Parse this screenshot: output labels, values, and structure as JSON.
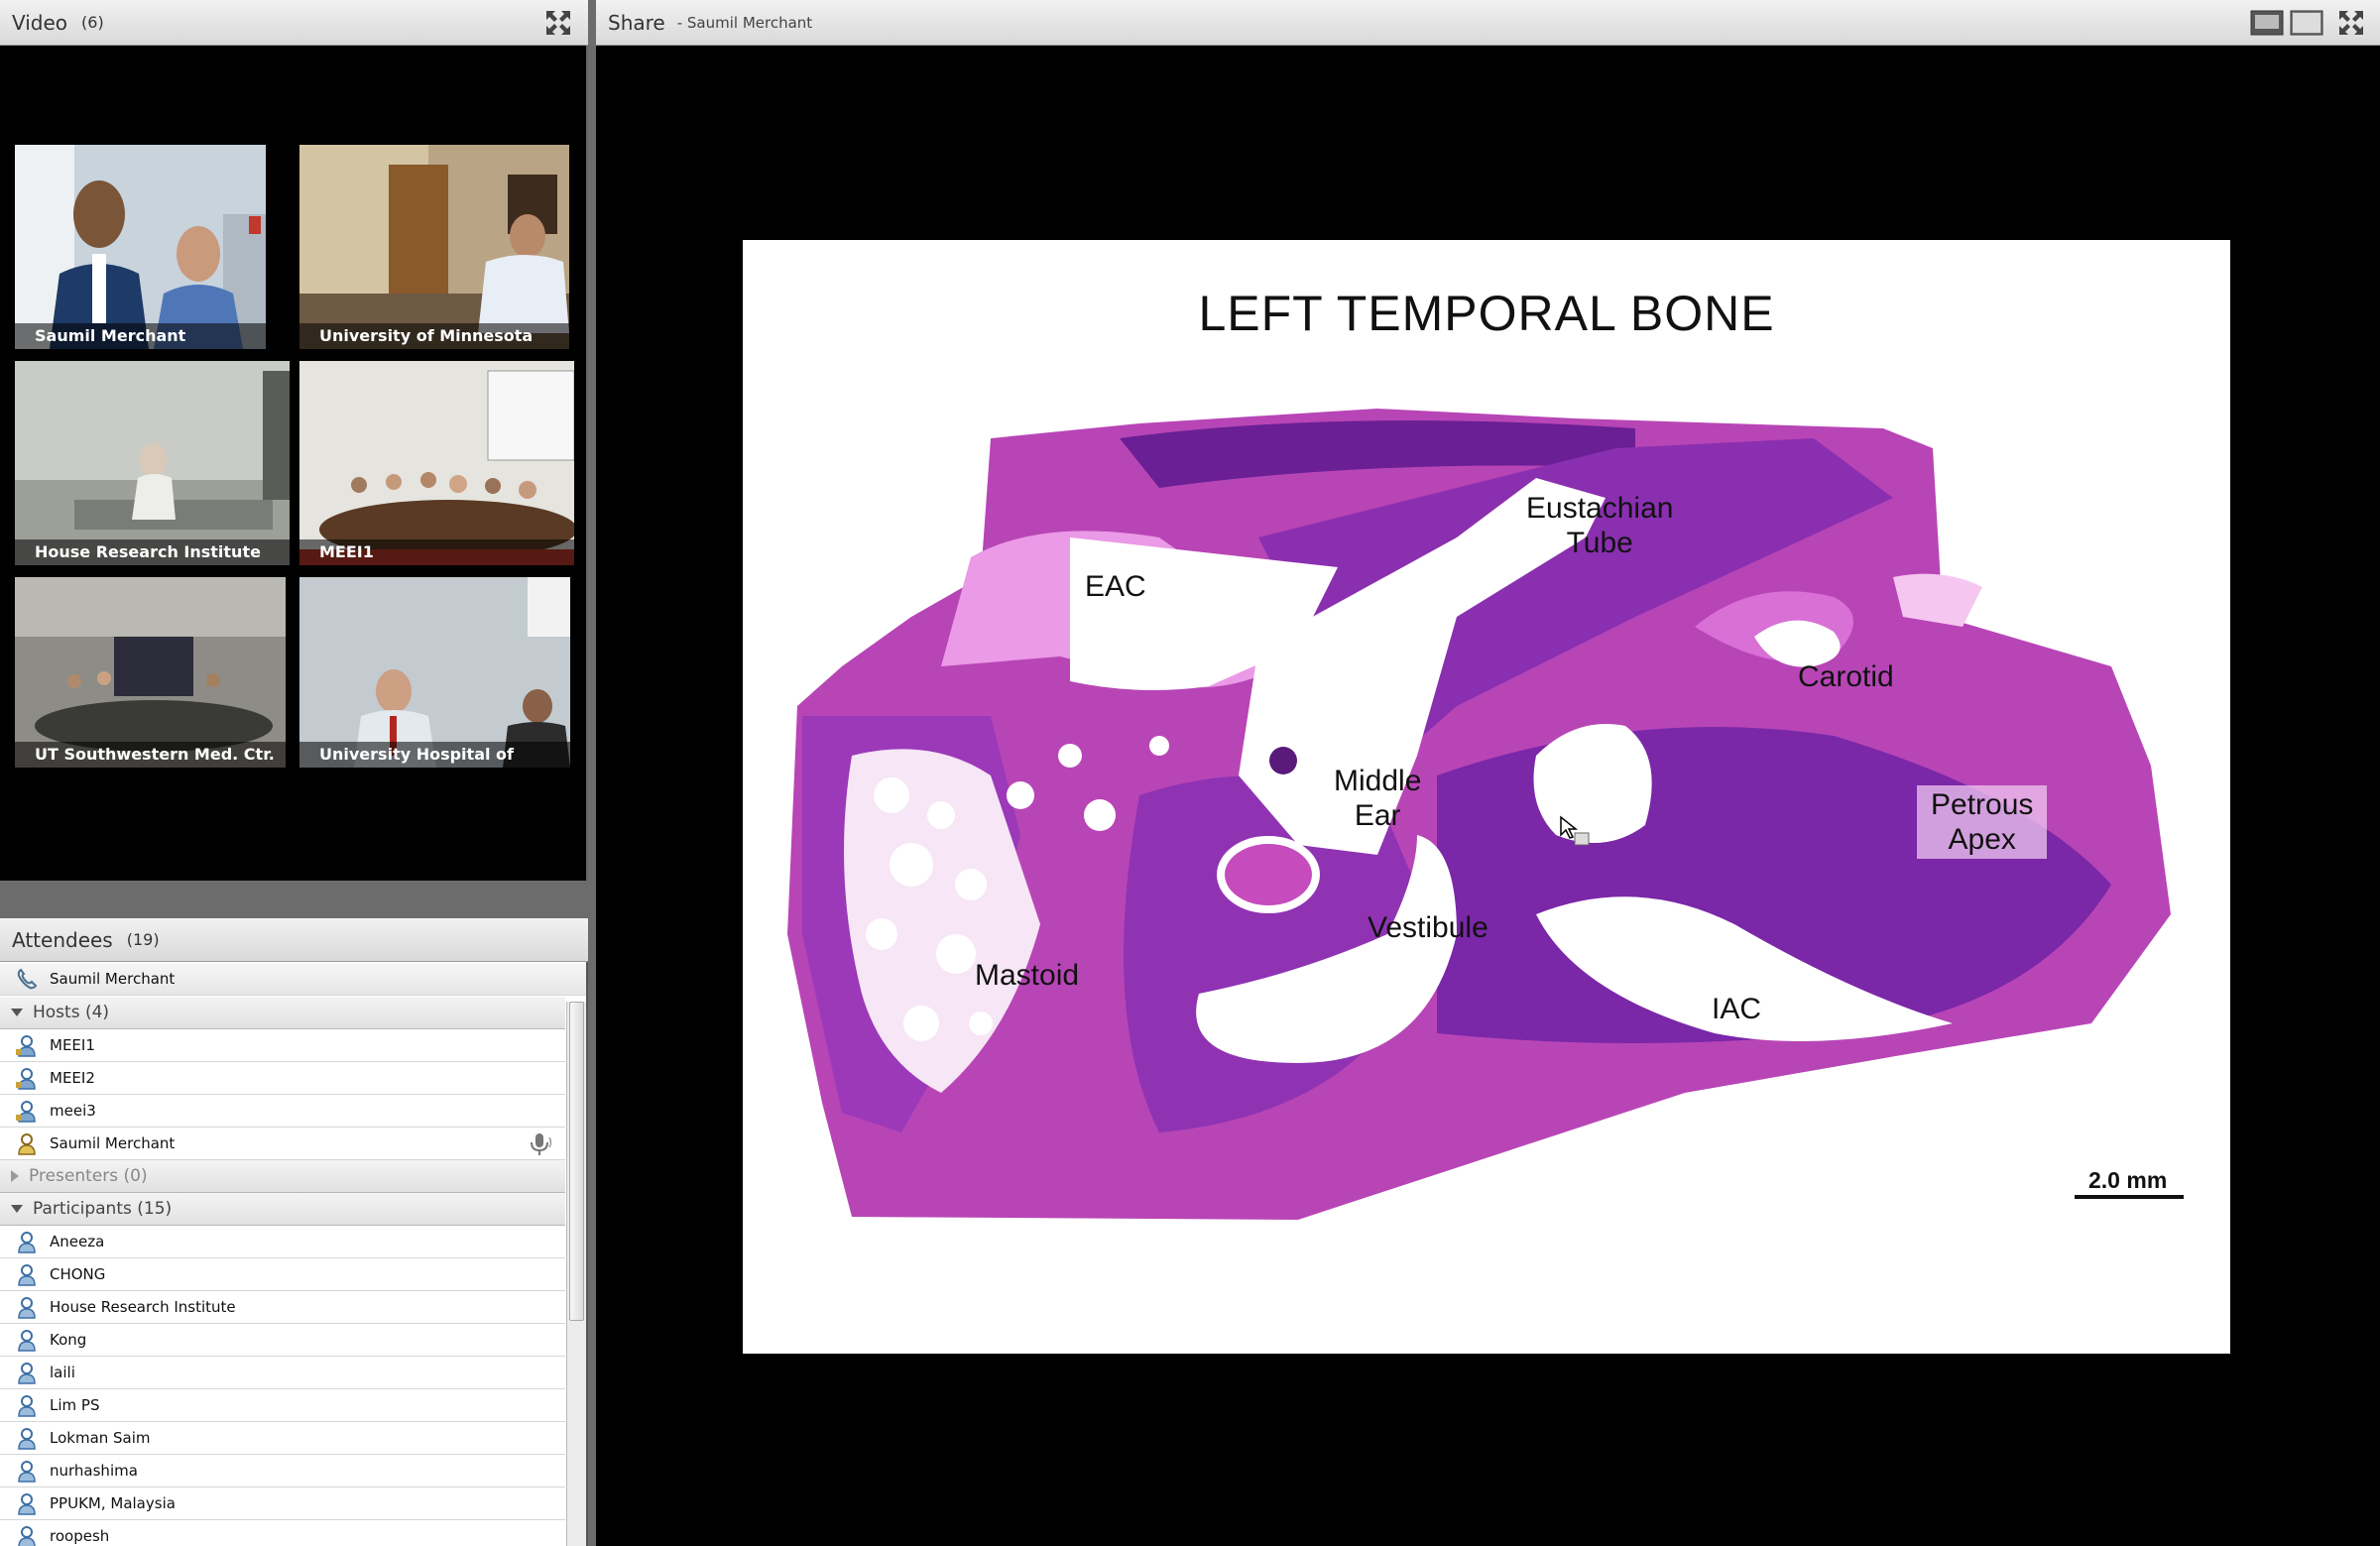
{
  "video_pod": {
    "title": "Video",
    "count": "(6)",
    "tiles": [
      {
        "name": "Saumil Merchant"
      },
      {
        "name": "University of Minnesota"
      },
      {
        "name": "House Research Institute"
      },
      {
        "name": "MEEI1"
      },
      {
        "name": "UT Southwestern Med. Ctr."
      },
      {
        "name": "University Hospital of Brasilia"
      }
    ]
  },
  "attendees_pod": {
    "title": "Attendees",
    "count": "(19)",
    "phone_user": "Saumil Merchant",
    "hosts_label": "Hosts (4)",
    "hosts": [
      "MEEI1",
      "MEEI2",
      "meei3",
      "Saumil Merchant"
    ],
    "presenters_label": "Presenters (0)",
    "participants_label": "Participants (15)",
    "participants": [
      "Aneeza",
      "CHONG",
      "House Research Institute",
      "Kong",
      "laili",
      "Lim PS",
      "Lokman Saim",
      "nurhashima",
      "PPUKM, Malaysia",
      "roopesh"
    ]
  },
  "share_pod": {
    "title": "Share",
    "subtitle": "- Saumil Merchant",
    "slide": {
      "title": "LEFT TEMPORAL BONE",
      "labels": {
        "eac": "EAC",
        "eustachian": "Eustachian\nTube",
        "carotid": "Carotid",
        "middle_ear": "Middle\nEar",
        "petrous": "Petrous\nApex",
        "vestibule": "Vestibule",
        "mastoid": "Mastoid",
        "iac": "IAC"
      },
      "scale_bar": "2.0 mm"
    }
  },
  "colors": {
    "header_bg": "#dedede",
    "stain_dark": "#6a1f94",
    "stain_light": "#c857c9"
  }
}
